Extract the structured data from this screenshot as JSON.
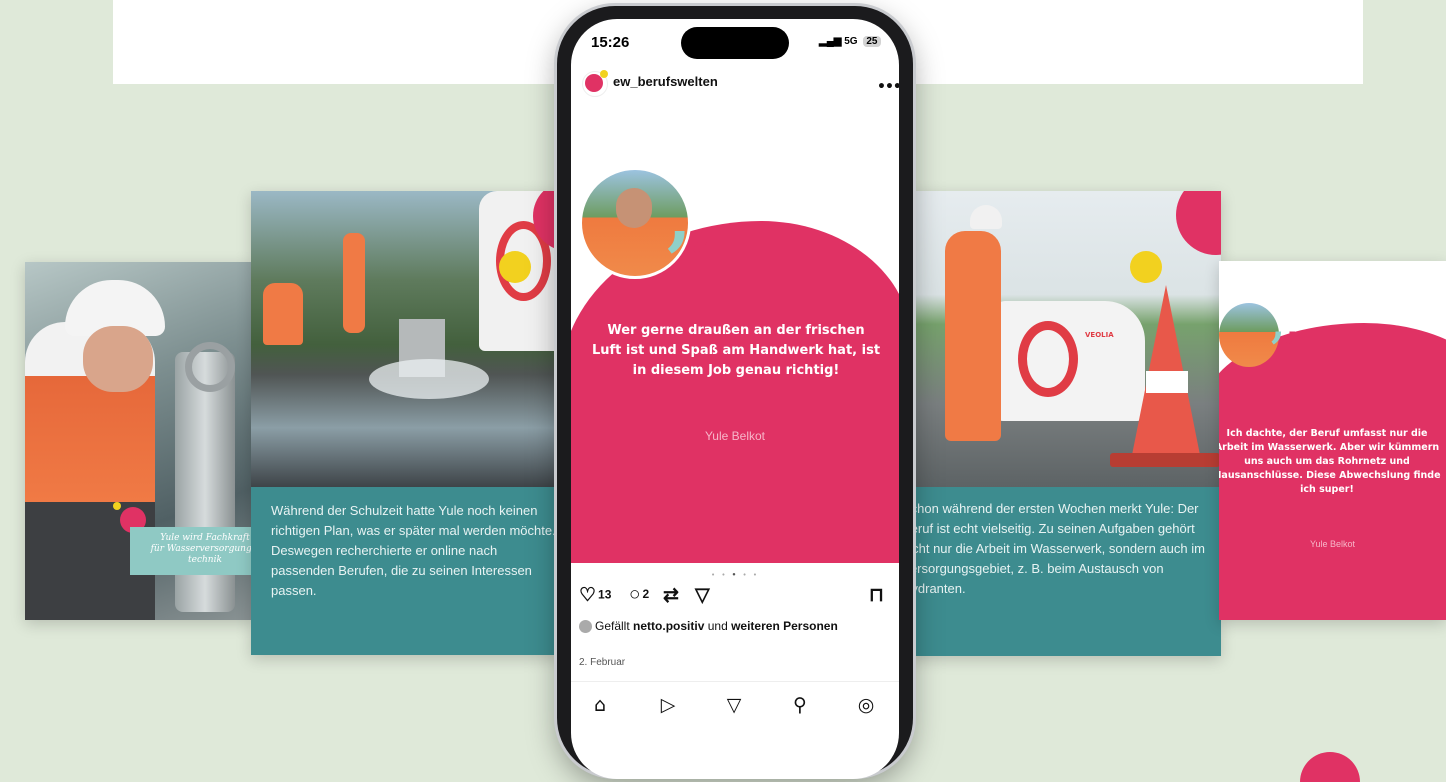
{
  "colors": {
    "background": "#dfe9d9",
    "pink": "#e03264",
    "teal": "#3d8c8f",
    "mint": "#8fd0c8",
    "yellow": "#f2d11f"
  },
  "card1": {
    "label_line1": "Yule wird Fachkraft",
    "label_line2": "für Wasserversorgungs-",
    "label_line3": "technik"
  },
  "card2": {
    "text": "Während der Schulzeit hatte Yule noch keinen richtigen Plan, was er später mal werden möchte. Deswegen recherchierte er online nach passenden Berufen, die zu seinen Interessen passen."
  },
  "phone": {
    "status_time": "15:26",
    "status_signal": "5G",
    "status_battery": "25",
    "username": "ew_berufswelten",
    "more_icon": "more-horizontal-icon",
    "quote_text": "Wer gerne draußen an der frischen Luft ist und Spaß am Handwerk hat, ist in diesem Job genau richtig!",
    "quote_author": "Yule Belkot",
    "like_count": "13",
    "comment_count": "2",
    "likes_prefix": "Gefällt",
    "likes_user": "netto.positiv",
    "likes_middle": "und",
    "likes_suffix": "weiteren Personen",
    "date": "2. Februar"
  },
  "card4": {
    "text": "Schon während der ersten Wochen merkt Yule: Der Beruf ist echt vielseitig. Zu seinen Aufgaben gehört nicht nur die Arbeit im Wasserwerk, sondern auch im Versorgungsgebiet, z. B. beim Austausch von Hydranten.",
    "van_brand": "VEOLIA"
  },
  "card5": {
    "quote_text": "Ich dachte, der Beruf umfasst nur die Arbeit im Wasserwerk. Aber wir kümmern uns auch um das Rohrnetz und Hausanschlüsse. Diese Abwechslung finde ich super!",
    "quote_author": "Yule Belkot"
  }
}
